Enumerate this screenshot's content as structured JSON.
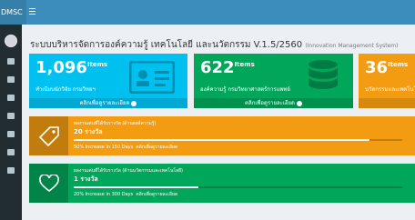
{
  "header": {
    "brand": "DMSC",
    "menu_icon": "bars-icon"
  },
  "page": {
    "title": "ระบบบริหารจัดการองค์ความรู้ เทคโนโลยี และนวัตกรรม V.1.5/2560",
    "subtitle": "(Innovation Management System)"
  },
  "tiles": [
    {
      "value": "1,096",
      "unit": "Items",
      "desc": "ทำเนียบนักวิจัย กรมวิทยฯ",
      "link": "คลิกเพื่อดูรายละเอียด",
      "color": "#00c0ef",
      "icon": "id-card-icon"
    },
    {
      "value": "622",
      "unit": "Items",
      "desc": "องค์ความรู้ กรมวิทยาศาสตร์การแพทย์",
      "link": "คลิกเพื่อดูรายละเอียด",
      "color": "#00a65a",
      "icon": "database-icon"
    },
    {
      "value": "36",
      "unit": "Items",
      "desc": "นวัตกรรมและเทคโนโลยี",
      "link": "",
      "color": "#f39c12",
      "icon": ""
    }
  ],
  "boxes": [
    {
      "label": "ผลงานเด่นที่ได้รับรางวัล (ด้านองค์ความรู้)",
      "value": "20 รางวัล",
      "progress_pct": 90,
      "caption": "50% Increase in 150 Days",
      "link": "คลิกเพื่อดูรายละเอียด",
      "color": "#f39c12",
      "icon": "tag-icon"
    },
    {
      "label": "ผลงานเด่นที่ได้รับรางวัล (ด้านนวัตกรรมและเทคโนโลยี)",
      "value": "1 รางวัล",
      "progress_pct": 38,
      "caption": "20% Increase in 300 Days",
      "link": "คลิกเพื่อดูรายละเอียด",
      "color": "#00a65a",
      "icon": "heart-icon"
    }
  ]
}
